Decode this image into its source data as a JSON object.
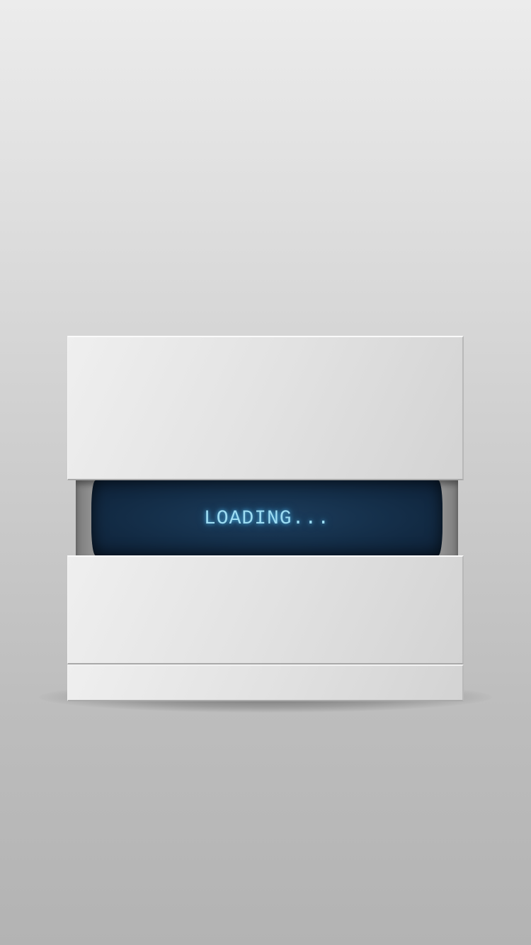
{
  "loader": {
    "status_text": "LOADING..."
  },
  "colors": {
    "screen_bg": "#15304b",
    "screen_text": "#9ddcf2",
    "panel": "#e2e2e2"
  }
}
